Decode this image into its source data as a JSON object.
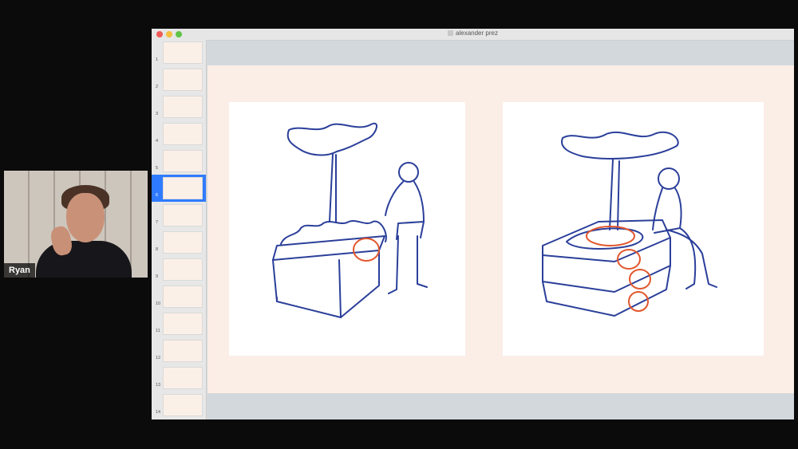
{
  "window": {
    "title": "alexander prez"
  },
  "participant": {
    "name": "Ryan"
  },
  "slides": [
    {
      "n": "1"
    },
    {
      "n": "2"
    },
    {
      "n": "3"
    },
    {
      "n": "4"
    },
    {
      "n": "5"
    },
    {
      "n": "6",
      "selected": true
    },
    {
      "n": "7"
    },
    {
      "n": "8"
    },
    {
      "n": "9"
    },
    {
      "n": "10"
    },
    {
      "n": "11"
    },
    {
      "n": "12"
    },
    {
      "n": "13"
    },
    {
      "n": "14"
    }
  ],
  "colors": {
    "ink": "#2b3f9a",
    "highlight": "#e2572e",
    "selection": "#2f7bff",
    "slide_bg": "#fbeee6"
  }
}
